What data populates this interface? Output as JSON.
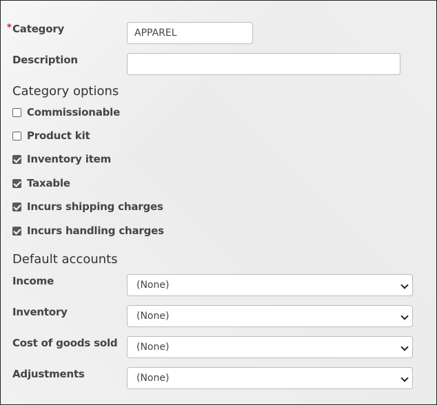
{
  "fields": {
    "category": {
      "label": "Category",
      "required_mark": "*",
      "value": "APPAREL"
    },
    "description": {
      "label": "Description",
      "value": ""
    }
  },
  "category_options": {
    "heading": "Category options",
    "items": [
      {
        "label": "Commissionable",
        "checked": false
      },
      {
        "label": "Product kit",
        "checked": false
      },
      {
        "label": "Inventory item",
        "checked": true
      },
      {
        "label": "Taxable",
        "checked": true
      },
      {
        "label": "Incurs shipping charges",
        "checked": true
      },
      {
        "label": "Incurs handling charges",
        "checked": true
      }
    ]
  },
  "default_accounts": {
    "heading": "Default accounts",
    "items": [
      {
        "label": "Income",
        "value": "(None)"
      },
      {
        "label": "Inventory",
        "value": "(None)"
      },
      {
        "label": "Cost of goods sold",
        "value": "(None)"
      },
      {
        "label": "Adjustments",
        "value": "(None)"
      }
    ]
  }
}
